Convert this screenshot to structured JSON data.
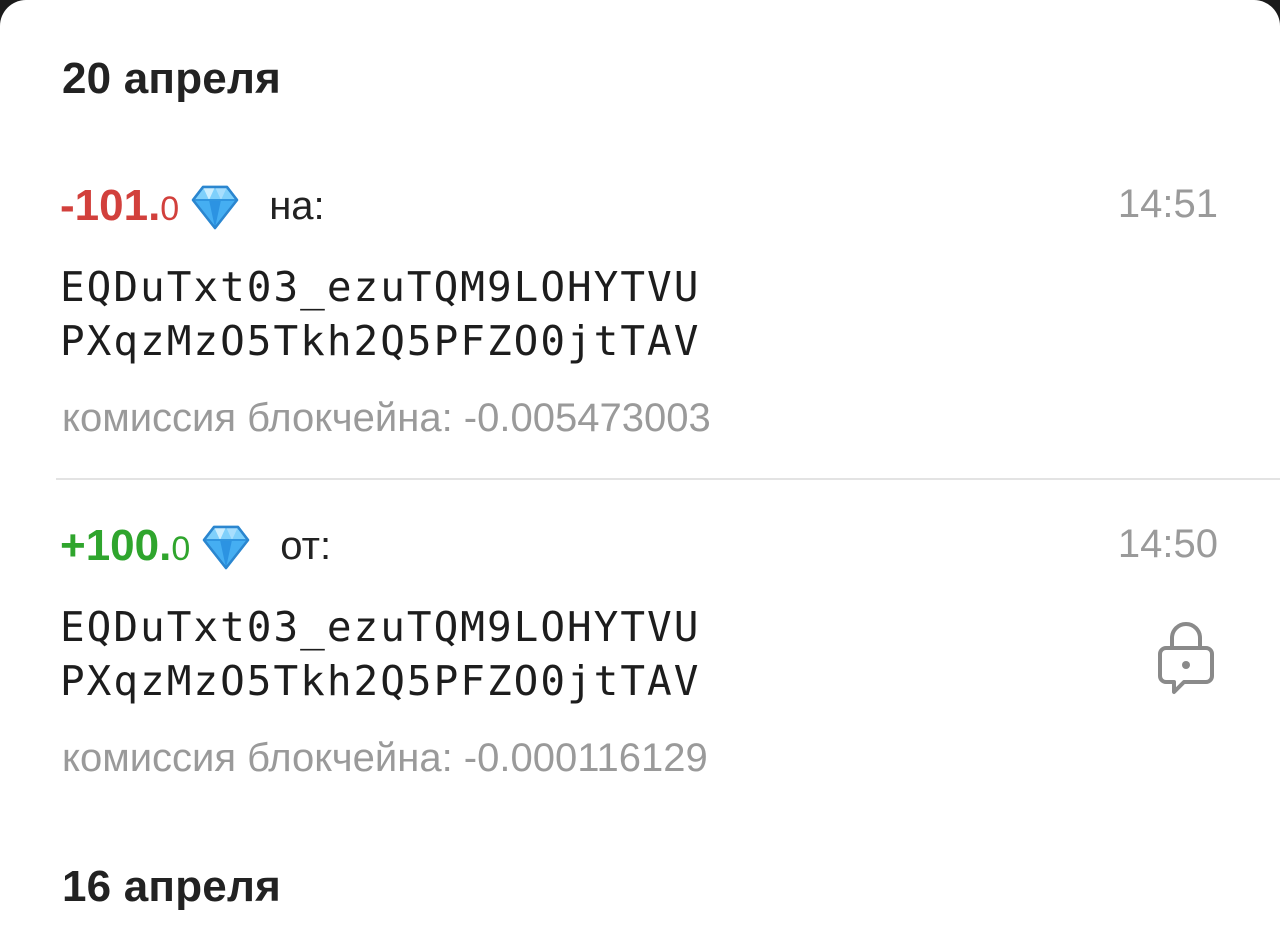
{
  "groups": [
    {
      "date": "20 апреля",
      "transactions": [
        {
          "amount_int": "-101.",
          "amount_frac": "0",
          "direction": "на:",
          "time": "14:51",
          "address_line1": "EQDuTxt03_ezuTQM9LOHYTVU",
          "address_line2": "PXqzMzO5Tkh2Q5PFZO0jtTAV",
          "fee": "комиссия блокчейна: -0.005473003",
          "currency_icon": "diamond-icon",
          "type": "outgoing"
        },
        {
          "amount_int": "+100.",
          "amount_frac": "0",
          "direction": "от:",
          "time": "14:50",
          "address_line1": "EQDuTxt03_ezuTQM9LOHYTVU",
          "address_line2": "PXqzMzO5Tkh2Q5PFZO0jtTAV",
          "fee": "комиссия блокчейна: -0.000116129",
          "currency_icon": "diamond-icon",
          "status_icon": "lock-message-icon",
          "type": "incoming"
        }
      ]
    },
    {
      "date": "16 апреля",
      "transactions": []
    }
  ],
  "colors": {
    "negative": "#d2403c",
    "positive": "#2fa52d",
    "secondary_text": "#9a9a9a",
    "gem": "#3fa9f5"
  }
}
